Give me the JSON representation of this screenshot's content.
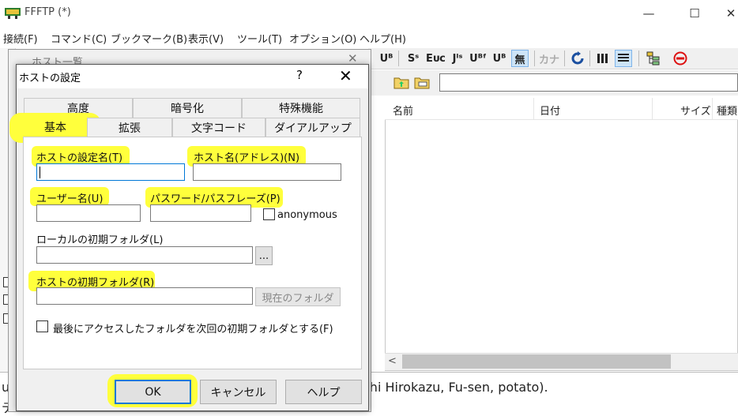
{
  "app": {
    "title": "FFFTP (*)"
  },
  "window_controls": {
    "minimize": "—",
    "maximize": "☐",
    "close": "✕"
  },
  "menu": [
    "接続(F)",
    "コマンド(C)",
    "ブックマーク(B)",
    "表示(V)",
    "ツール(T)",
    "オプション(O)",
    "ヘルプ(H)"
  ],
  "toolbar": {
    "items": [
      "U8",
      "SS",
      "Eu",
      "Js",
      "U8F",
      "U8",
      "無",
      "カナ",
      "refresh-icon",
      "list-icon",
      "details-icon",
      "tree-icon",
      "stop-icon"
    ],
    "labels": {
      "a": "Uᴮ",
      "b": "Sˢ",
      "c": "Eᴜᴄ",
      "d": "Jᴵˢ",
      "e": "Uᴮᶠ",
      "f": "Uᴮ",
      "g": "無",
      "h": "カナ"
    }
  },
  "file_list": {
    "columns": [
      "名前",
      "日付",
      "サイズ",
      "種類"
    ]
  },
  "log": {
    "line1_start": "un",
    "line1_end": "chi Hirokazu, Fu-sen, potato).",
    "line2": "デ"
  },
  "hostlist_window": {
    "title": "ホスト一覧",
    "close": "✕"
  },
  "dialog": {
    "title": "ホストの設定",
    "help": "?",
    "close": "✕",
    "tabs_row1": [
      "高度",
      "暗号化",
      "特殊機能"
    ],
    "tabs_row2": [
      "基本",
      "拡張",
      "文字コード",
      "ダイアルアップ"
    ],
    "fields": {
      "host_setting_name": {
        "label": "ホストの設定名(T)",
        "value": ""
      },
      "host_name": {
        "label": "ホスト名(アドレス)(N)",
        "value": ""
      },
      "user_name": {
        "label": "ユーザー名(U)",
        "value": ""
      },
      "password": {
        "label": "パスワード/パスフレーズ(P)",
        "value": ""
      },
      "anonymous": {
        "label": "anonymous",
        "checked": false
      },
      "local_folder": {
        "label": "ローカルの初期フォルダ(L)",
        "value": "",
        "browse": "..."
      },
      "host_folder": {
        "label": "ホストの初期フォルダ(R)",
        "value": "",
        "current_button": "現在のフォルダ"
      },
      "last_access": {
        "label": "最後にアクセスしたフォルダを次回の初期フォルダとする(F)",
        "checked": false
      }
    },
    "buttons": {
      "ok": "OK",
      "cancel": "キャンセル",
      "help": "ヘルプ"
    }
  },
  "colors": {
    "highlight": "#ffff3c",
    "focus": "#0078d7",
    "window_bg": "#f0f0f0"
  }
}
